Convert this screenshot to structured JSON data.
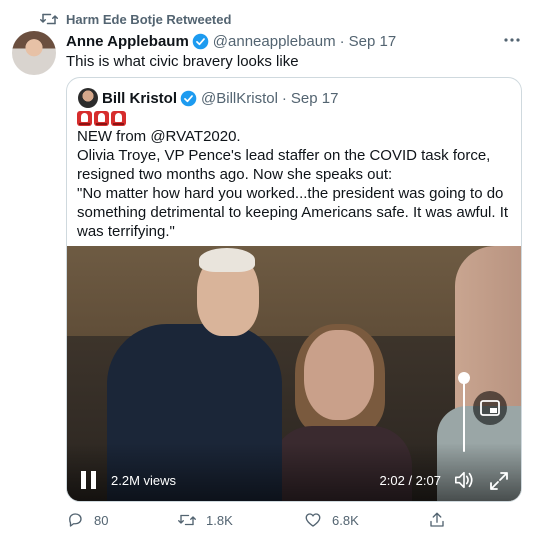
{
  "retweet_bar": {
    "text": "Harm Ede Botje Retweeted"
  },
  "tweet": {
    "author_name": "Anne Applebaum",
    "handle": "@anneapplebaum",
    "separator": "·",
    "time": "Sep 17",
    "text": "This is what civic bravery looks like"
  },
  "quoted": {
    "author_name": "Bill Kristol",
    "handle": "@BillKristol",
    "separator": "·",
    "time": "Sep 17",
    "lines": [
      "NEW from @RVAT2020.",
      "Olivia Troye, VP Pence's lead staffer on the COVID task force, resigned two months ago. Now she speaks out:",
      "\"No matter how hard you worked...the president was going to do something detrimental to keeping Americans safe. It was awful. It was terrifying.\""
    ]
  },
  "video": {
    "views": "2.2M views",
    "time": "2:02 / 2:07",
    "volume_level": 1.0
  },
  "actions": {
    "replies": "80",
    "retweets": "1.8K",
    "likes": "6.8K"
  },
  "colors": {
    "verified": "#1d9bf0",
    "muted_text": "#536471",
    "border": "#cfd9de",
    "siren": "#d62d2d"
  },
  "icons": [
    "retweet-icon",
    "verified-icon",
    "more-icon",
    "siren-icon",
    "pause-icon",
    "volume-icon",
    "fullscreen-icon",
    "picture-in-picture-icon",
    "reply-icon",
    "like-icon",
    "share-icon"
  ]
}
